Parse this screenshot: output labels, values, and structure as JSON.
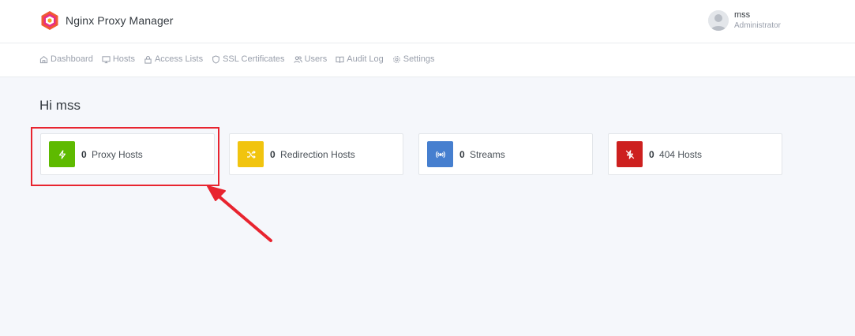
{
  "app": {
    "title": "Nginx Proxy Manager",
    "logo_icon": "nginx-proxy-manager-logo"
  },
  "user": {
    "name": "mss",
    "role": "Administrator",
    "avatar_icon": "user-avatar-icon"
  },
  "nav": {
    "items": [
      {
        "label": "Dashboard",
        "icon": "home-icon"
      },
      {
        "label": "Hosts",
        "icon": "monitor-icon"
      },
      {
        "label": "Access Lists",
        "icon": "lock-icon"
      },
      {
        "label": "SSL Certificates",
        "icon": "shield-icon"
      },
      {
        "label": "Users",
        "icon": "users-icon"
      },
      {
        "label": "Audit Log",
        "icon": "book-icon"
      },
      {
        "label": "Settings",
        "icon": "gear-icon"
      }
    ]
  },
  "dashboard": {
    "greeting": "Hi mss",
    "cards": [
      {
        "count": "0",
        "label": "Proxy Hosts",
        "icon": "zap-icon",
        "color": "#5eba00"
      },
      {
        "count": "0",
        "label": "Redirection Hosts",
        "icon": "shuffle-icon",
        "color": "#f1c40f"
      },
      {
        "count": "0",
        "label": "Streams",
        "icon": "radio-icon",
        "color": "#467fcf"
      },
      {
        "count": "0",
        "label": "404 Hosts",
        "icon": "zap-off-icon",
        "color": "#cd201f"
      }
    ]
  },
  "annotation": {
    "color": "#e8242f"
  }
}
